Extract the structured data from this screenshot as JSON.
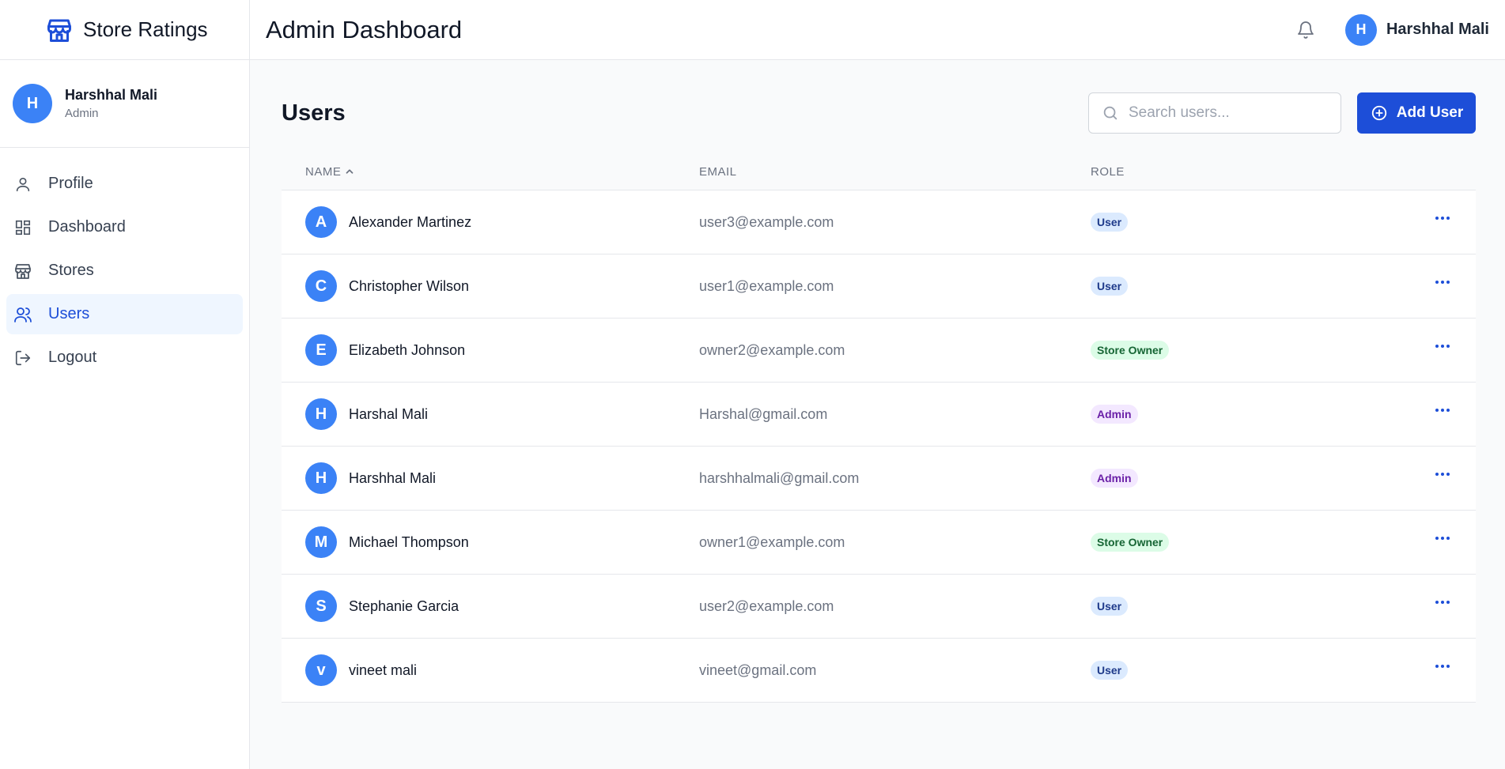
{
  "app": {
    "name": "Store Ratings"
  },
  "sidebar": {
    "user": {
      "initial": "H",
      "name": "Harshhal Mali",
      "role": "Admin"
    },
    "items": [
      {
        "label": "Profile",
        "icon": "user-icon"
      },
      {
        "label": "Dashboard",
        "icon": "grid-icon"
      },
      {
        "label": "Stores",
        "icon": "store-icon"
      },
      {
        "label": "Users",
        "icon": "users-icon",
        "active": true
      },
      {
        "label": "Logout",
        "icon": "logout-icon"
      }
    ]
  },
  "header": {
    "title": "Admin Dashboard",
    "user": {
      "initial": "H",
      "name": "Harshhal Mali"
    }
  },
  "main": {
    "title": "Users",
    "search": {
      "placeholder": "Search users...",
      "value": ""
    },
    "add_button": "Add User",
    "table": {
      "columns": {
        "name": "NAME",
        "email": "EMAIL",
        "role": "ROLE"
      },
      "rows": [
        {
          "initial": "A",
          "name": "Alexander Martinez",
          "email": "user3@example.com",
          "role": "User"
        },
        {
          "initial": "C",
          "name": "Christopher Wilson",
          "email": "user1@example.com",
          "role": "User"
        },
        {
          "initial": "E",
          "name": "Elizabeth Johnson",
          "email": "owner2@example.com",
          "role": "Store Owner"
        },
        {
          "initial": "H",
          "name": "Harshal Mali",
          "email": "Harshal@gmail.com",
          "role": "Admin"
        },
        {
          "initial": "H",
          "name": "Harshhal Mali",
          "email": "harshhalmali@gmail.com",
          "role": "Admin"
        },
        {
          "initial": "M",
          "name": "Michael Thompson",
          "email": "owner1@example.com",
          "role": "Store Owner"
        },
        {
          "initial": "S",
          "name": "Stephanie Garcia",
          "email": "user2@example.com",
          "role": "User"
        },
        {
          "initial": "v",
          "name": "vineet mali",
          "email": "vineet@gmail.com",
          "role": "User"
        }
      ]
    }
  },
  "colors": {
    "accent": "#1d4ed8",
    "avatar": "#3b82f6",
    "active_bg": "#eff6ff"
  }
}
